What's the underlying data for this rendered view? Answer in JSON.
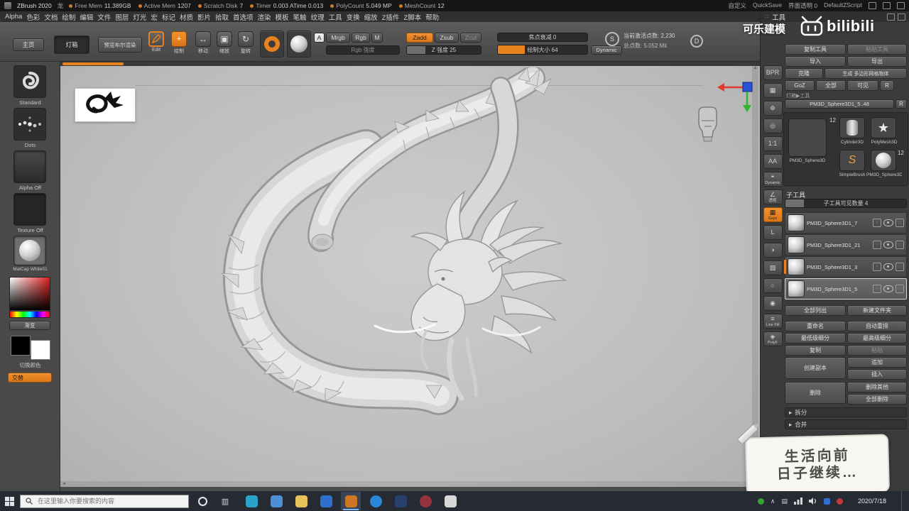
{
  "colors": {
    "accent": "#e8821e",
    "canvas": "#c4c4c4"
  },
  "titlebar": {
    "app_name": "ZBrush 2020",
    "doc_name": "龙",
    "stats": [
      {
        "label": "Free Mem",
        "value": "11.389GB"
      },
      {
        "label": "Active Mem",
        "value": "1207"
      },
      {
        "label": "Scratch Disk",
        "value": "7"
      },
      {
        "label": "Timer",
        "value": "0.003 ATime 0.013"
      },
      {
        "label": "PolyCount",
        "value": "5.049 MP"
      },
      {
        "label": "MeshCount",
        "value": "12"
      }
    ],
    "right_items": [
      "自定义",
      "QuickSave",
      "界面透明 0",
      "DefaultZScript"
    ]
  },
  "menubar": {
    "items": [
      "Alpha",
      "色彩",
      "文档",
      "绘制",
      "编辑",
      "文件",
      "图层",
      "灯光",
      "宏",
      "标记",
      "材质",
      "影片",
      "拾取",
      "首选项",
      "渲染",
      "模板",
      "笔触",
      "纹理",
      "工具",
      "变换",
      "缩放",
      "Z插件",
      "Z脚本",
      "帮助"
    ]
  },
  "toolbar": {
    "home": "主页",
    "lightbox": "灯箱",
    "preview_boolean": "预览布尔渲染",
    "edit": "Edit",
    "draw": "绘制",
    "move": "移动",
    "scale": "缩放",
    "rotate": "旋转",
    "a": "A",
    "mrgb": "Mrgb",
    "rgb": "Rgb",
    "m": "M",
    "rgb_intensity": "Rgb 强度",
    "zadd": "Zadd",
    "zsub": "Zsub",
    "zcut": "Zcut",
    "z_intensity": "Z 强度 25",
    "focal_shift": "焦点衰减 0",
    "draw_size": "绘制大小 64",
    "dynamic": "Dynamic",
    "active_points": "当前激活点数: 2,230",
    "total_points": "总点数: 5.052 Mil"
  },
  "left_panel": {
    "brush_label": "Standard",
    "stroke_label": "Dots",
    "alpha_label": "Alpha Off",
    "texture_label": "Texture Off",
    "material_label": "MatCap White01",
    "gradient_label": "渐变",
    "switch_color_label": "切换颜色",
    "swap_label": "交替"
  },
  "shelf": {
    "items": [
      {
        "name": "bpr-render-button",
        "glyph": "BPR",
        "label": ""
      },
      {
        "name": "subpixel-aa-button",
        "glyph": "▦",
        "label": ""
      },
      {
        "name": "scroll-canvas-button",
        "glyph": "⊕",
        "label": ""
      },
      {
        "name": "zoom-canvas-button",
        "glyph": "◎",
        "label": ""
      },
      {
        "name": "actual-size-button",
        "glyph": "1:1",
        "label": ""
      },
      {
        "name": "aa-half-button",
        "glyph": "AA",
        "label": ""
      },
      {
        "name": "dynamic-persp-button",
        "glyph": "◓",
        "label": "Dynamic"
      },
      {
        "name": "perspective-button",
        "glyph": "∠",
        "label": "透视"
      },
      {
        "name": "floor-grid-button",
        "glyph": "▦",
        "label": "Gxyz",
        "active": true
      },
      {
        "name": "local-transform-button",
        "glyph": "L",
        "label": ""
      },
      {
        "name": "lsym-button",
        "glyph": "◑",
        "label": ""
      },
      {
        "name": "transparency-button",
        "glyph": "▨",
        "label": ""
      },
      {
        "name": "ghost-button",
        "glyph": "○",
        "label": ""
      },
      {
        "name": "solo-button",
        "glyph": "◉",
        "label": ""
      },
      {
        "name": "line-fill-button",
        "glyph": "≡",
        "label": "Line Fill"
      },
      {
        "name": "polyframe-button",
        "glyph": "◈",
        "label": "PolyF"
      }
    ]
  },
  "tool_panel": {
    "title": "工具",
    "buttons": {
      "copy_tool": "复制工具",
      "paste_tool": "粘贴工具",
      "import": "导入",
      "export": "导出",
      "clone": "克隆",
      "make_polymesh": "生成 多边形网格物体",
      "goz": "GoZ",
      "all": "全部",
      "visible": "可见",
      "r": "R"
    },
    "tool_path_label": "灯箱▶工具",
    "active_tool_name": "PM3D_Sphere3D1_5..48",
    "inventory": {
      "badge_top": "12",
      "active_label": "PM3D_Sphere3D",
      "cylinder_label": "Cylinder3D",
      "polymesh_label": "PolyMesh3D",
      "simplebrush_label": "SimpleBrush",
      "sphere_label": "PM3D_Sphere3D",
      "badge_sphere": "12"
    },
    "subtool": {
      "title": "子工具",
      "count_slider": "子工具可见数量 4",
      "items": [
        {
          "label": "PM3D_Sphere3D1_7"
        },
        {
          "label": "PM3D_Sphere3D1_21"
        },
        {
          "label": "PM3D_Sphere3D1_3",
          "marked": true
        },
        {
          "label": "PM3D_Sphere3D1_5",
          "selected": true
        }
      ],
      "list_all": "全部列出",
      "new_folder": "新建文件夹",
      "actions": {
        "rename": "重命名",
        "auto_reorder": "自动重排",
        "lowest_subdiv": "最低级细分",
        "highest_subdiv": "最高级细分",
        "copy": "复制",
        "paste": "粘贴",
        "duplicate": "创建副本",
        "append": "追加",
        "insert": "插入",
        "delete": "删除",
        "delete_other": "删除其他",
        "delete_all": "全部删除",
        "split": "拆分",
        "merge": "合并"
      }
    }
  },
  "watermark": {
    "channel": "可乐建模",
    "logo_text": "bilibili"
  },
  "note_overlay": {
    "line1": "生活向前",
    "line2": "日子继续…"
  },
  "taskbar": {
    "search_placeholder": "在这里输入你要搜索的内容",
    "date": "2020/7/18",
    "apps": [
      {
        "name": "pinned-app-tv",
        "color": "#2ba3c9"
      },
      {
        "name": "pinned-app-chat",
        "color": "#4c8fd6"
      },
      {
        "name": "pinned-app-explorer",
        "color": "#e8c35a"
      },
      {
        "name": "pinned-app-blue",
        "color": "#2f6fd0"
      },
      {
        "name": "taskbar-zbrush-app",
        "color": "#cd7722",
        "active": true
      },
      {
        "name": "pinned-app-edge",
        "color": "#2b88d8",
        "circle": true
      },
      {
        "name": "pinned-app-dark",
        "color": "#27406e"
      },
      {
        "name": "pinned-app-red",
        "color": "#96323e",
        "circle": true
      },
      {
        "name": "pinned-app-grid",
        "color": "#d8d8d8"
      }
    ]
  }
}
